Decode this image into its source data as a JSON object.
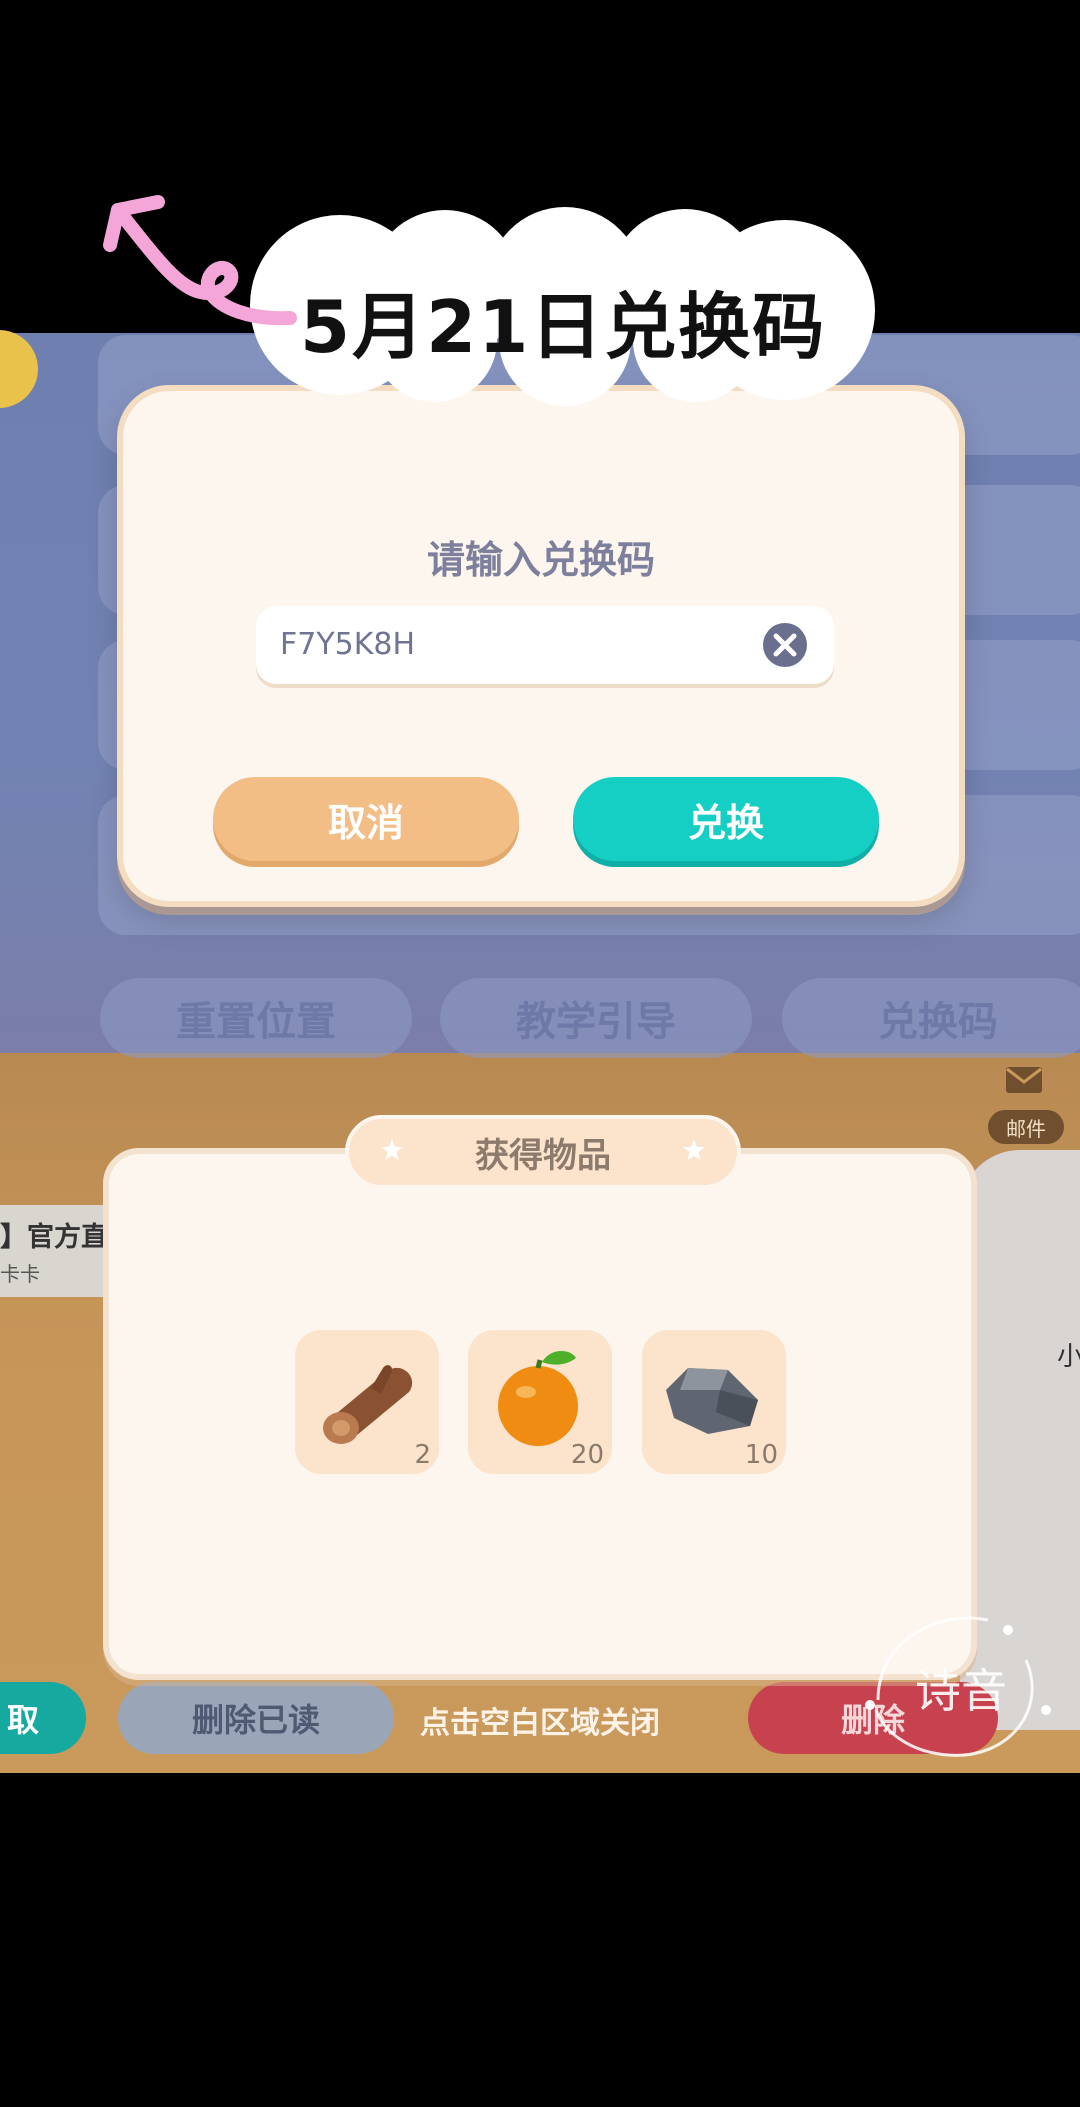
{
  "banner": {
    "title": "5月21日兑换码"
  },
  "background": {
    "settings_buttons": [
      "重置位置",
      "教学引导",
      "兑换码"
    ],
    "mail_label": "邮件",
    "mail_list": {
      "item_title": "】官方直",
      "item_sub": "卡卡",
      "right_fragment": "小"
    },
    "bottom_bar": {
      "left_button": "取",
      "delete_read": "删除已读",
      "delete": "删除"
    }
  },
  "redeem_dialog": {
    "title": "请输入兑换码",
    "code_value": "F7Y5K8H",
    "cancel_label": "取消",
    "exchange_label": "兑换"
  },
  "items_dialog": {
    "title": "获得物品",
    "items": [
      {
        "icon": "wood-log-icon",
        "count": "2"
      },
      {
        "icon": "orange-icon",
        "count": "20"
      },
      {
        "icon": "stone-icon",
        "count": "10"
      }
    ],
    "close_hint": "点击空白区域关闭"
  },
  "watermark": {
    "text": "诗音"
  },
  "colors": {
    "accent": "#16cfc4",
    "cancel": "#f2be86",
    "panel": "#fdf6ee"
  }
}
